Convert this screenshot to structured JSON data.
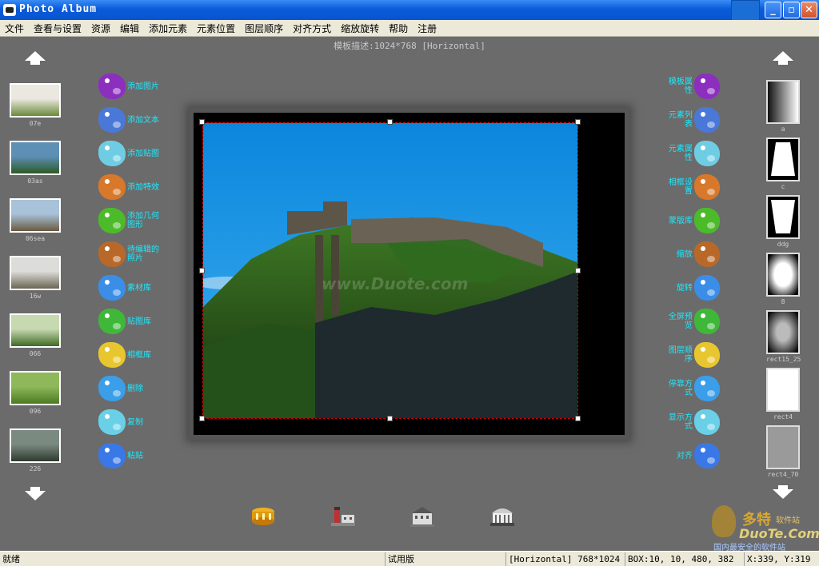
{
  "window": {
    "title": "Photo Album",
    "minimize": "_",
    "maximize": "▫",
    "close": "✕"
  },
  "menu": [
    "文件",
    "查看与设置",
    "资源",
    "编辑",
    "添加元素",
    "元素位置",
    "图层顺序",
    "对齐方式",
    "缩放旋转",
    "帮助",
    "注册"
  ],
  "template_desc": "模板描述:1024*768 [Horizontal]",
  "thumbnails": [
    {
      "caption": "07e",
      "colors": [
        "#eae8e0",
        "#6a8a3a"
      ]
    },
    {
      "caption": "03as",
      "colors": [
        "#5e8fb5",
        "#2c5a25"
      ]
    },
    {
      "caption": "06sea",
      "colors": [
        "#a7c2d9",
        "#6a5a40"
      ]
    },
    {
      "caption": "16w",
      "colors": [
        "#dcdcd8",
        "#6b6552"
      ]
    },
    {
      "caption": "066",
      "colors": [
        "#c7d9b0",
        "#3f6b25"
      ]
    },
    {
      "caption": "096",
      "colors": [
        "#8fb85a",
        "#4b7a22"
      ]
    },
    {
      "caption": "226",
      "colors": [
        "#7a8a80",
        "#2e3a30"
      ]
    }
  ],
  "tools_left": [
    {
      "label": "添加图片",
      "icon": "dragon-icon",
      "color": "#8c2fbf"
    },
    {
      "label": "添加文本",
      "icon": "bird-icon",
      "color": "#4a78d8"
    },
    {
      "label": "添加贴图",
      "icon": "fish-icon",
      "color": "#6fcde3"
    },
    {
      "label": "添加特效",
      "icon": "dog-icon",
      "color": "#d8782a"
    },
    {
      "label": "添加几何图形",
      "icon": "frog-icon",
      "color": "#4cbb2a"
    },
    {
      "label": "待编辑的照片",
      "icon": "owl-icon",
      "color": "#b8692a"
    },
    {
      "label": "素材库",
      "icon": "dragon-blue-icon",
      "color": "#3a8ee8"
    },
    {
      "label": "贴图库",
      "icon": "bird-green-icon",
      "color": "#3fb83a"
    },
    {
      "label": "相框库",
      "icon": "hamster-icon",
      "color": "#e8c630"
    },
    {
      "label": "删除",
      "icon": "seahorse-icon",
      "color": "#3a9ee8"
    },
    {
      "label": "复制",
      "icon": "fox-icon",
      "color": "#6ad0e8"
    },
    {
      "label": "粘贴",
      "icon": "turtle-icon",
      "color": "#3a78e8"
    }
  ],
  "tools_right": [
    {
      "label": "模板属性",
      "icon": "dragon-icon",
      "color": "#8c2fbf"
    },
    {
      "label": "元素列表",
      "icon": "bird-icon",
      "color": "#4a78d8"
    },
    {
      "label": "元素属性",
      "icon": "fish-icon",
      "color": "#6fcde3"
    },
    {
      "label": "相框设置",
      "icon": "dog-icon",
      "color": "#d8782a"
    },
    {
      "label": "蒙版库",
      "icon": "frog-icon",
      "color": "#4cbb2a"
    },
    {
      "label": "缩放",
      "icon": "owl-icon",
      "color": "#b8692a"
    },
    {
      "label": "旋转",
      "icon": "dragon-blue-icon",
      "color": "#3a8ee8"
    },
    {
      "label": "全屏预览",
      "icon": "bird-green-icon",
      "color": "#3fb83a"
    },
    {
      "label": "图层顺序",
      "icon": "hamster-icon",
      "color": "#e8c630"
    },
    {
      "label": "停靠方式",
      "icon": "seahorse-icon",
      "color": "#3a9ee8"
    },
    {
      "label": "显示方式",
      "icon": "fox-icon",
      "color": "#6ad0e8"
    },
    {
      "label": "对齐",
      "icon": "turtle-icon",
      "color": "#3a78e8"
    }
  ],
  "masks": [
    {
      "caption": "a",
      "type": "gradient"
    },
    {
      "caption": "c",
      "type": "trapezoid"
    },
    {
      "caption": "ddg",
      "type": "cup"
    },
    {
      "caption": "8",
      "type": "soft"
    },
    {
      "caption": "rect15_25",
      "type": "softgray"
    },
    {
      "caption": "rect4",
      "type": "white"
    },
    {
      "caption": "rect4_70",
      "type": "gray"
    }
  ],
  "canvas": {
    "watermark": "www.Duote.com"
  },
  "bottom_icons": [
    "drum-icon",
    "lighthouse-icon",
    "building-icon",
    "temple-icon"
  ],
  "brand": {
    "name": "多特",
    "suffix": "软件站",
    "url": "DuoTe.Com",
    "slogan": "国内最安全的软件站"
  },
  "status": {
    "ready": "就绪",
    "edition": "试用版",
    "orientation": "[Horizontal] 768*1024",
    "box": "BOX:10, 10, 480, 382",
    "coords": "X:339, Y:319"
  }
}
